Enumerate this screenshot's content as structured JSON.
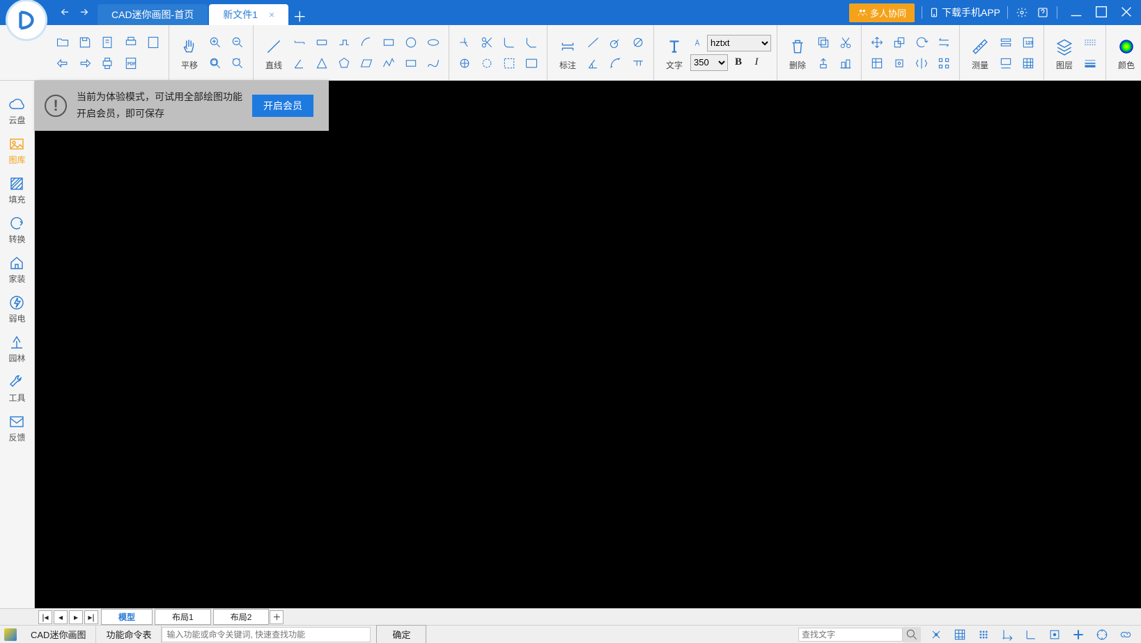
{
  "title_bar": {
    "tabs": [
      {
        "label": "CAD迷你画图-首页",
        "active": false
      },
      {
        "label": "新文件1",
        "active": true
      }
    ],
    "collab": "多人协同",
    "download": "下载手机APP"
  },
  "ribbon": {
    "pan": "平移",
    "line": "直线",
    "annotate": "标注",
    "text": "文字",
    "font": "hztxt",
    "size": "350",
    "delete": "删除",
    "measure": "测量",
    "layer": "图层",
    "color": "颜色",
    "color_swatches": [
      "#ffffff",
      "#ff0000",
      "#f5a21b",
      "#ffe600",
      "#8bc34a",
      "#000000",
      "#7b1fa2",
      "#2196f3",
      "#4caf50",
      "#607d8b"
    ]
  },
  "sidebar": {
    "items": [
      {
        "label": "云盘",
        "icon": "cloud"
      },
      {
        "label": "图库",
        "icon": "image",
        "active": true
      },
      {
        "label": "填充",
        "icon": "hatch"
      },
      {
        "label": "转换",
        "icon": "refresh"
      },
      {
        "label": "家装",
        "icon": "home"
      },
      {
        "label": "弱电",
        "icon": "power"
      },
      {
        "label": "园林",
        "icon": "tree"
      },
      {
        "label": "工具",
        "icon": "wrench"
      },
      {
        "label": "反馈",
        "icon": "mail"
      }
    ]
  },
  "notice": {
    "line1": "当前为体验模式，可试用全部绘图功能",
    "line2": "开启会员，即可保存",
    "button": "开启会员"
  },
  "layout_tabs": {
    "tabs": [
      "模型",
      "布局1",
      "布局2"
    ]
  },
  "statusbar": {
    "app": "CAD迷你画图",
    "cmd_table": "功能命令表",
    "cmd_placeholder": "输入功能或命令关键词, 快速查找功能",
    "confirm": "确定",
    "search_placeholder": "查找文字"
  }
}
